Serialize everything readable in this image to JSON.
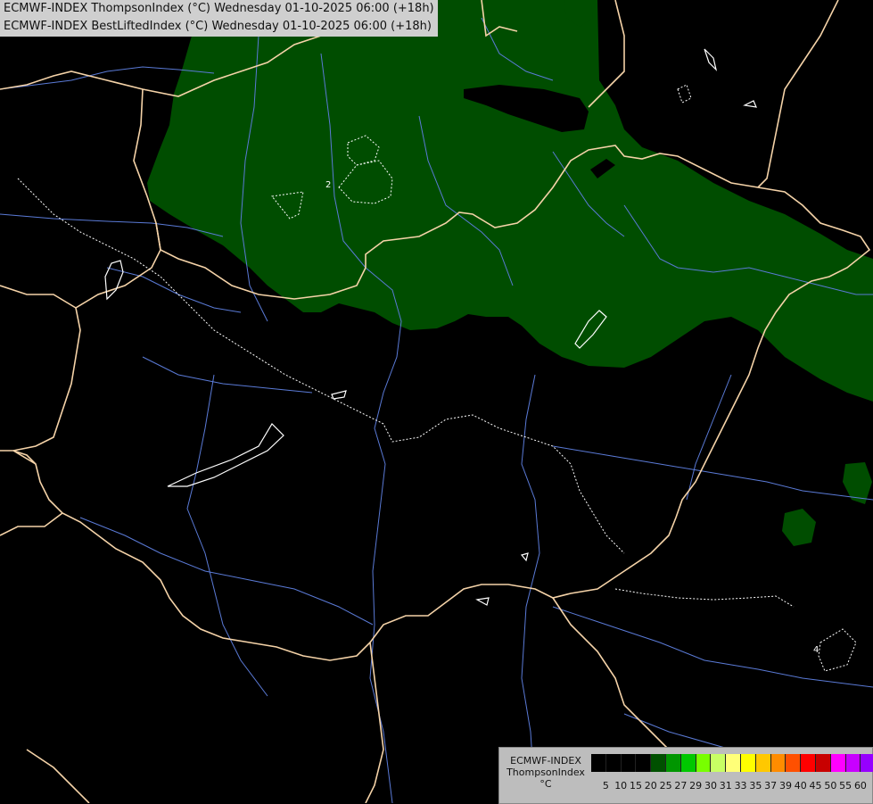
{
  "header": {
    "line1": "ECMWF-INDEX ThompsonIndex (°C) Wednesday 01-10-2025 06:00 (+18h)",
    "line2": "ECMWF-INDEX BestLiftedIndex (°C) Wednesday 01-10-2025 06:00 (+18h)"
  },
  "map": {
    "contour_label": "2",
    "contour_label_east": "4"
  },
  "legend": {
    "model": "ECMWF-INDEX",
    "parameter": "ThompsonIndex",
    "unit": "°C",
    "ticks": [
      "5",
      "10",
      "15",
      "20",
      "25",
      "27",
      "29",
      "30",
      "31",
      "33",
      "35",
      "37",
      "39",
      "40",
      "45",
      "50",
      "55",
      "60"
    ],
    "colors": [
      "#000000",
      "#000000",
      "#000000",
      "#000000",
      "#005000",
      "#009600",
      "#00c800",
      "#78ff00",
      "#c8ff64",
      "#ffff78",
      "#ffff00",
      "#ffc800",
      "#ff8c00",
      "#ff5000",
      "#ff0000",
      "#c80000",
      "#ff00ff",
      "#c800ff",
      "#9600ff",
      "#0000ff"
    ]
  },
  "colors": {
    "background": "#000000",
    "thompson_area": "#004d00",
    "borders": "#f5d3a8",
    "rivers": "#5a7ad6",
    "lakes": "#ffffff",
    "lifted_contours": "#ffffff"
  }
}
